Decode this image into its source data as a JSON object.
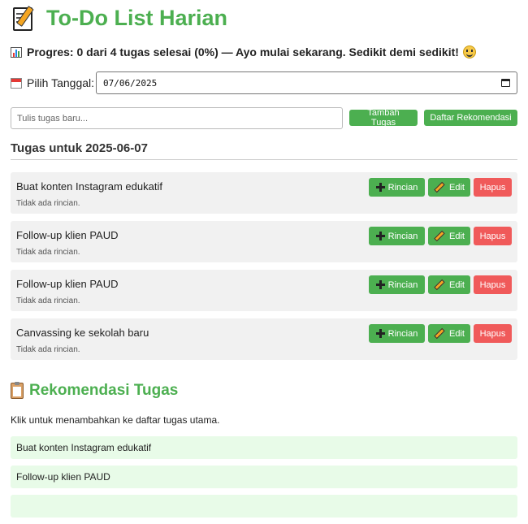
{
  "header": {
    "title": "To-Do List Harian",
    "icon": "memo-icon"
  },
  "progress": {
    "text": "Progres: 0 dari 4 tugas selesai (0%) — Ayo mulai sekarang. Sedikit demi sedikit!",
    "icon": "bar-chart-icon",
    "emoji": "smiling-face-icon"
  },
  "date": {
    "label": "Pilih Tanggal:",
    "value": "07/06/2025",
    "icon": "calendar-icon"
  },
  "new_task": {
    "placeholder": "Tulis tugas baru...",
    "add_label": "Tambah Tugas",
    "recommend_label": "Daftar Rekomendasi"
  },
  "tasks_section": {
    "heading": "Tugas untuk 2025-06-07"
  },
  "tasks": [
    {
      "name": "Buat konten Instagram edukatif",
      "detail": "Tidak ada rincian."
    },
    {
      "name": "Follow-up klien PAUD",
      "detail": "Tidak ada rincian."
    },
    {
      "name": "Follow-up klien PAUD",
      "detail": "Tidak ada rincian."
    },
    {
      "name": "Canvassing ke sekolah baru",
      "detail": "Tidak ada rincian."
    }
  ],
  "task_actions": {
    "detail_label": "Rincian",
    "edit_label": "Edit",
    "delete_label": "Hapus"
  },
  "recommendations": {
    "heading": "Rekomendasi Tugas",
    "icon": "clipboard-icon",
    "hint": "Klik untuk menambahkan ke daftar tugas utama.",
    "items": [
      "Buat konten Instagram edukatif",
      "Follow-up klien PAUD"
    ]
  },
  "colors": {
    "accent": "#4caf50",
    "danger": "#f05a5a",
    "task_bg": "#f1f1f1",
    "rec_bg": "#e8fbe8"
  }
}
